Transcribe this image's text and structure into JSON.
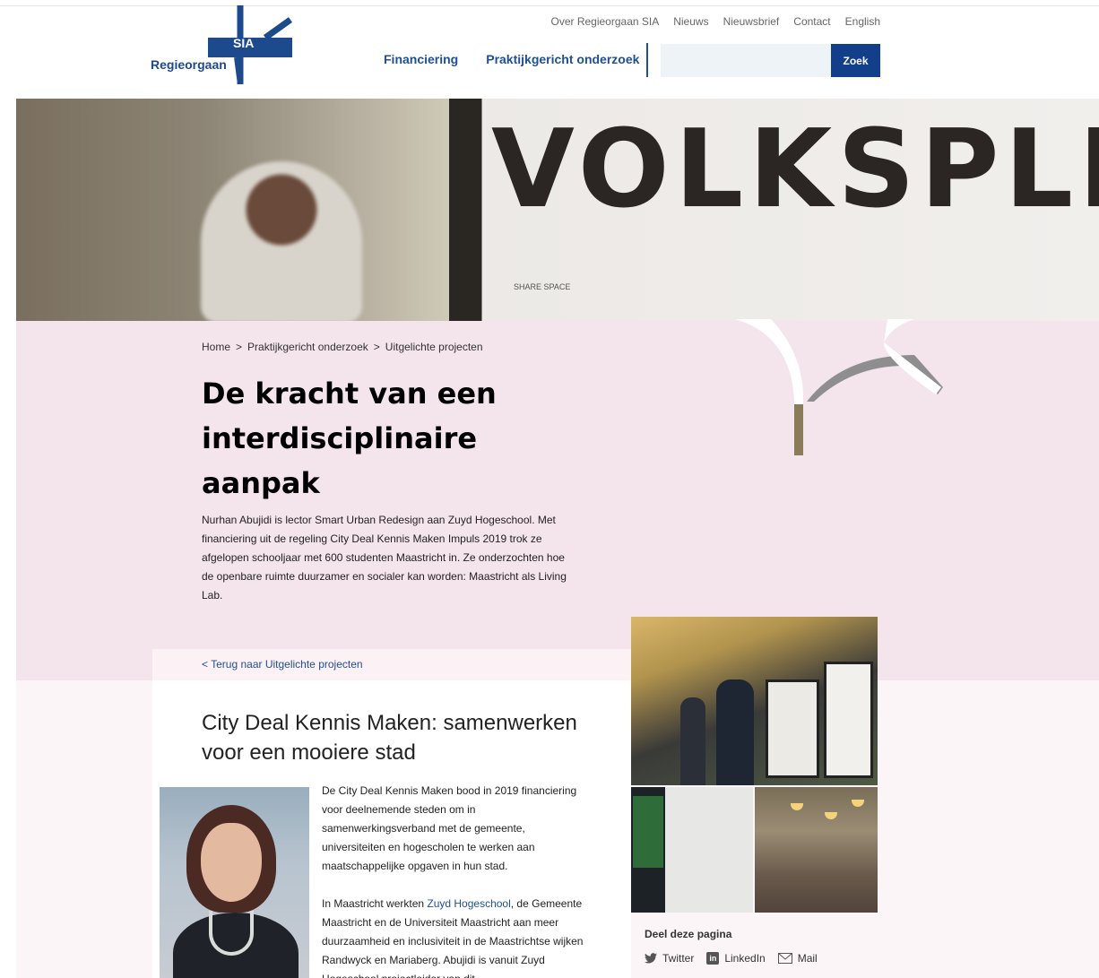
{
  "logo": {
    "word": "Regieorgaan",
    "sia": "SIA"
  },
  "utility_nav": [
    "Over Regieorgaan SIA",
    "Nieuws",
    "Nieuwsbrief",
    "Contact",
    "English"
  ],
  "main_nav": [
    "Financiering",
    "Praktijkgericht onderzoek"
  ],
  "search": {
    "placeholder": "",
    "button_label": "Zoek"
  },
  "hero": {
    "sign_text": "VOLKSPLEIN",
    "sign_small": "SHARE SPACE"
  },
  "breadcrumb": [
    "Home",
    "Praktijkgericht onderzoek",
    "Uitgelichte projecten"
  ],
  "breadcrumb_separator": ">",
  "page_title": "De kracht van een interdisciplinaire aanpak",
  "intro": "Nurhan Abujidi is lector Smart Urban Redesign aan Zuyd Hogeschool. Met financiering uit de regeling City Deal Kennis Maken Impuls 2019 trok ze afgelopen schooljaar met 600 studenten Maastricht in. Ze onderzochten hoe de openbare ruimte duurzamer en socialer kan worden: Maastricht als Living Lab.",
  "back_link": "< Terug naar Uitgelichte projecten",
  "subtitle": "City Deal Kennis Maken: samenwerken voor een mooiere stad",
  "body": {
    "p1": "De City Deal Kennis Maken bood in 2019 financiering voor deelnemende steden om in samenwerkingsverband met de gemeente, universiteiten en hogescholen te werken aan maatschappelijke opgaven in hun stad.",
    "p2_before": "In Maastricht werkten ",
    "p2_link": "Zuyd Hogeschool",
    "p2_after": ", de Gemeente Maastricht en de Universiteit Maastricht aan meer duurzaamheid en inclusiviteit in de Maastrichtse wijken Randwyck en Mariaberg. Abujidi is vanuit Zuyd Hogeschool projectleider van dit"
  },
  "share": {
    "title": "Deel deze pagina",
    "twitter": "Twitter",
    "linkedin": "LinkedIn",
    "mail": "Mail"
  },
  "colors": {
    "brand_blue": "#1f4f94",
    "button_blue": "#123e8a",
    "pink_band": "#f4e4eb"
  }
}
